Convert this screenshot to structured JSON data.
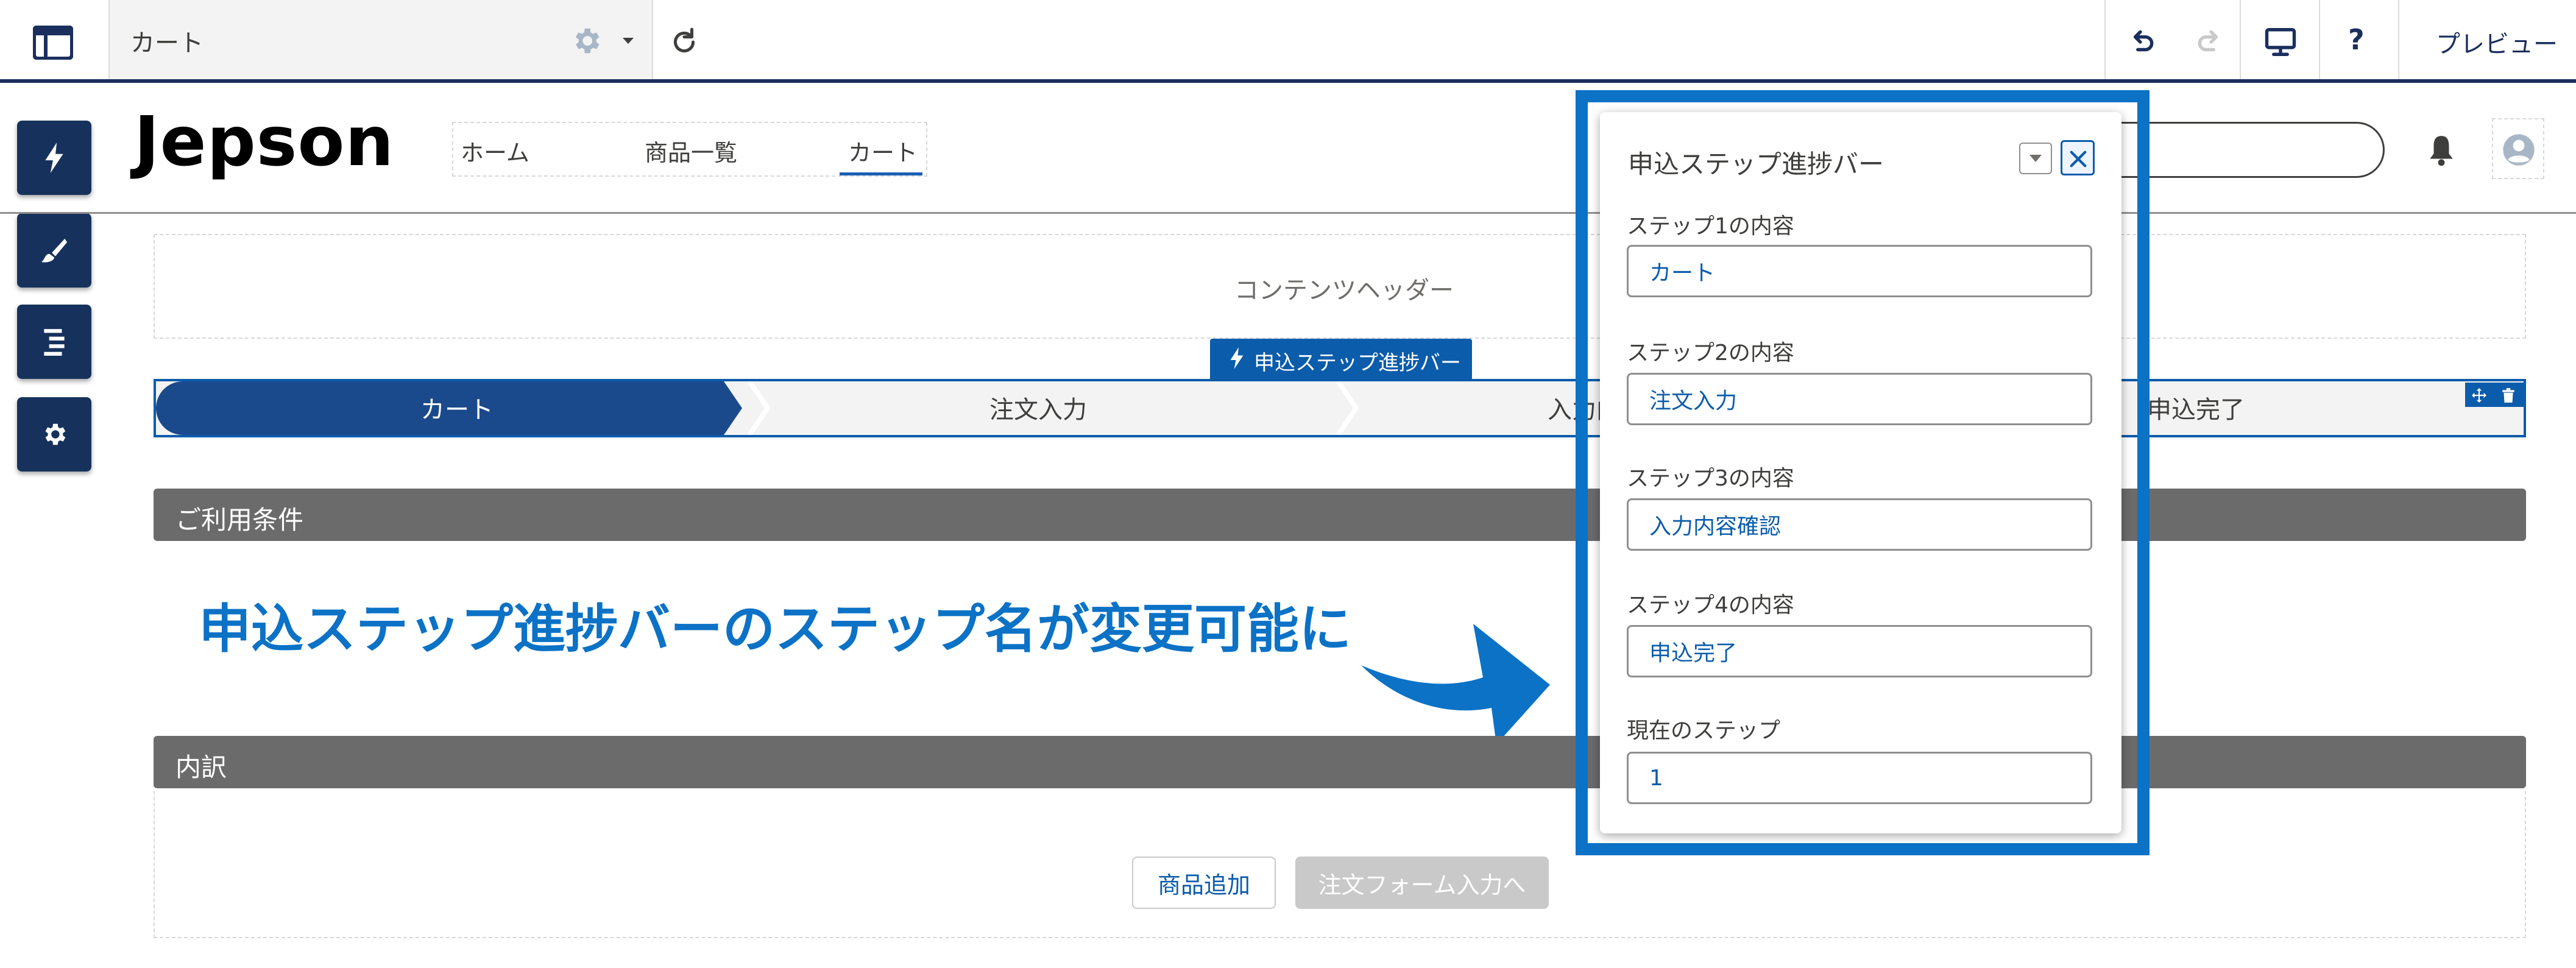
{
  "toolbar": {
    "page_title": "カート",
    "preview_label": "プレビュー",
    "help_label": "?"
  },
  "site": {
    "logo": "Jepson",
    "nav": [
      "ホーム",
      "商品一覧",
      "カート"
    ]
  },
  "content": {
    "content_header_label": "コンテンツヘッダー",
    "component_tag": "申込ステップ進捗バー",
    "steps": [
      "カート",
      "注文入力",
      "入力内",
      "申込完了"
    ],
    "current_step_index": 1,
    "section_terms": "ご利用条件",
    "section_breakdown": "内訳",
    "annotation": "申込ステップ進捗バーのステップ名が変更可能に",
    "buttons": {
      "add_product": "商品追加",
      "to_order_form": "注文フォーム入力へ"
    }
  },
  "panel": {
    "title": "申込ステップ進捗バー",
    "fields": [
      {
        "label": "ステップ1の内容",
        "value": "カート"
      },
      {
        "label": "ステップ2の内容",
        "value": "注文入力"
      },
      {
        "label": "ステップ3の内容",
        "value": "入力内容確認"
      },
      {
        "label": "ステップ4の内容",
        "value": "申込完了"
      },
      {
        "label": "現在のステップ",
        "value": "1"
      }
    ]
  },
  "colors": {
    "accent": "#0b5cab",
    "rail": "#16325c",
    "annotation": "#0b72c6",
    "section_bar": "#6b6b6b"
  },
  "icons": [
    "layout-icon",
    "gear-icon",
    "caret-down-icon",
    "refresh-icon",
    "undo-icon",
    "redo-icon",
    "desktop-icon",
    "lightning-icon",
    "brush-icon",
    "list-icon",
    "settings-icon",
    "bell-icon",
    "avatar-icon",
    "move-icon",
    "trash-icon",
    "close-icon",
    "arrow-icon"
  ]
}
